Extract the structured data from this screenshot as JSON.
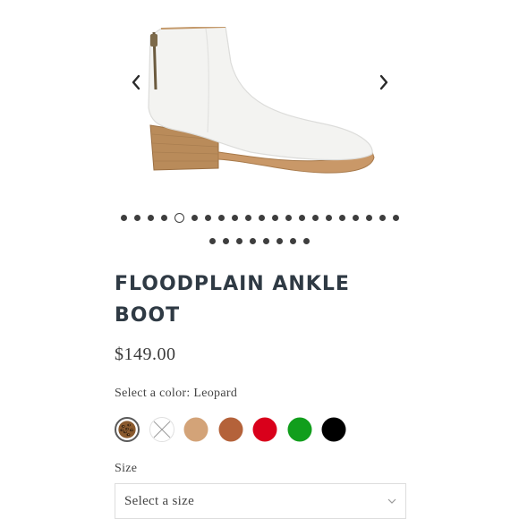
{
  "product": {
    "title": "FLOODPLAIN ANKLE BOOT",
    "price": "$149.00",
    "image_alt": "White leather ankle boot with stacked wooden heel"
  },
  "gallery": {
    "slide_count": 29,
    "active_index": 4,
    "prev_icon": "chevron-left-icon",
    "next_icon": "chevron-right-icon"
  },
  "color": {
    "label": "Select a color: Leopard",
    "selected": "Leopard",
    "swatches": [
      {
        "name": "Leopard",
        "color": "#8a5a2e",
        "pattern": "leopard",
        "available": true
      },
      {
        "name": "White",
        "color": "#ffffff",
        "available": false
      },
      {
        "name": "Tan",
        "color": "#d3a378",
        "available": true
      },
      {
        "name": "Cognac",
        "color": "#b4623a",
        "available": true
      },
      {
        "name": "Red",
        "color": "#d9001b",
        "available": true
      },
      {
        "name": "Green",
        "color": "#119e1c",
        "available": true
      },
      {
        "name": "Black",
        "color": "#000000",
        "available": true
      }
    ]
  },
  "size": {
    "label": "Size",
    "placeholder": "Select a size",
    "icon": "chevron-down-icon"
  },
  "colors": {
    "text_dark": "#2f3a44",
    "dot": "#3e3e3e"
  }
}
